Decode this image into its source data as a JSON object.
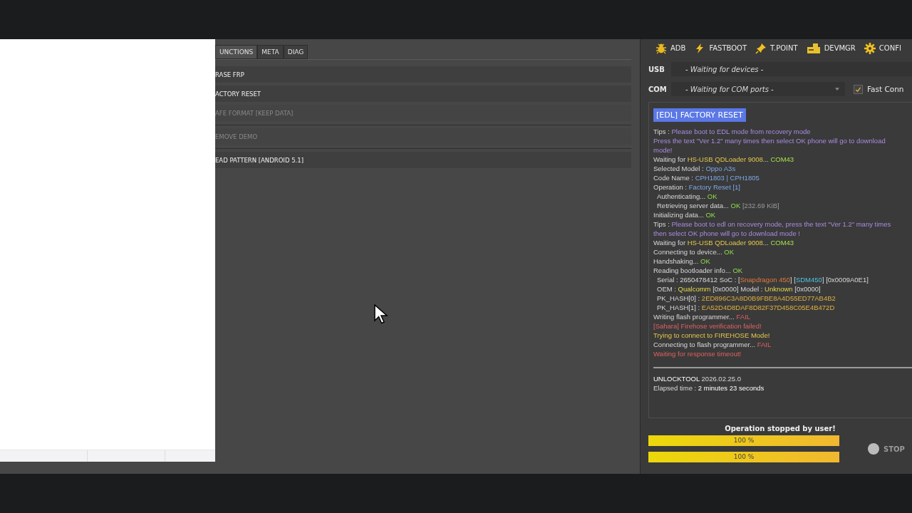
{
  "tabs": [
    {
      "label": "UNCTIONS",
      "selected": true
    },
    {
      "label": "META",
      "selected": false
    },
    {
      "label": "DIAG",
      "selected": false
    }
  ],
  "functions": [
    {
      "label": "RASE FRP",
      "disabled": false
    },
    {
      "label": "ACTORY RESET",
      "disabled": false
    },
    {
      "label": "AFE FORMAT [KEEP DATA]",
      "disabled": true
    },
    {
      "label": "EMOVE DEMO",
      "disabled": true
    },
    {
      "label": "EAD PATTERN [ANDROID 5.1]",
      "disabled": false
    }
  ],
  "toolbar": [
    {
      "label": "ADB",
      "kind": "bug"
    },
    {
      "label": "FASTBOOT",
      "kind": "bolt"
    },
    {
      "label": "T.POINT",
      "kind": "pin"
    },
    {
      "label": "DEVMGR",
      "kind": "device"
    },
    {
      "label": "CONFI",
      "kind": "gear"
    }
  ],
  "usb": {
    "label": "USB",
    "value": "- Waiting for devices -"
  },
  "com": {
    "label": "COM",
    "value": "- Waiting for COM ports -"
  },
  "fast_connect": {
    "label": "Fast Conn",
    "checked": true
  },
  "log_title": "[EDL] FACTORY RESET",
  "log": [
    {
      "indent": false,
      "parts": [
        {
          "text": "Tips : ",
          "kind": "plain"
        },
        {
          "text": "Please boot to EDL mode from recovery mode",
          "kind": "tip"
        }
      ]
    },
    {
      "indent": false,
      "parts": [
        {
          "text": "Press the text \"Ver 1.2\" many times then select OK phone will go to download mode!",
          "kind": "tip"
        }
      ]
    },
    {
      "indent": false,
      "parts": [
        {
          "text": "Waiting for ",
          "kind": "plain"
        },
        {
          "text": "HS-USB QDLoader 9008",
          "kind": "device"
        },
        {
          "text": "... ",
          "kind": "plain"
        },
        {
          "text": "COM43",
          "kind": "port"
        }
      ]
    },
    {
      "indent": false,
      "parts": [
        {
          "text": "Selected Model : ",
          "kind": "plain"
        },
        {
          "text": "Oppo A3s",
          "kind": "value"
        }
      ]
    },
    {
      "indent": false,
      "parts": [
        {
          "text": "Code Name : ",
          "kind": "plain"
        },
        {
          "text": "CPH1803 | CPH1805",
          "kind": "value"
        }
      ]
    },
    {
      "indent": false,
      "parts": [
        {
          "text": "Operation : ",
          "kind": "plain"
        },
        {
          "text": "Factory Reset [1]",
          "kind": "value"
        }
      ]
    },
    {
      "indent": true,
      "parts": [
        {
          "text": "Authenticating... ",
          "kind": "plain"
        },
        {
          "text": "OK",
          "kind": "ok"
        }
      ]
    },
    {
      "indent": true,
      "parts": [
        {
          "text": "Retrieving server data... ",
          "kind": "plain"
        },
        {
          "text": "OK ",
          "kind": "ok"
        },
        {
          "text": "[232.69 KiB]",
          "kind": "muted"
        }
      ]
    },
    {
      "indent": false,
      "parts": [
        {
          "text": "Initializing data... ",
          "kind": "plain"
        },
        {
          "text": "OK",
          "kind": "ok"
        }
      ]
    },
    {
      "indent": false,
      "parts": [
        {
          "text": "Tips : ",
          "kind": "plain"
        },
        {
          "text": "Please boot to edl on recovery mode, press the text \"Ver 1.2\" many times then select OK phone will go to download mode !",
          "kind": "tip"
        }
      ]
    },
    {
      "indent": false,
      "parts": [
        {
          "text": "Waiting for ",
          "kind": "plain"
        },
        {
          "text": "HS-USB QDLoader 9008",
          "kind": "device"
        },
        {
          "text": "... ",
          "kind": "plain"
        },
        {
          "text": "COM43",
          "kind": "port"
        }
      ]
    },
    {
      "indent": false,
      "parts": [
        {
          "text": "Connecting to device... ",
          "kind": "plain"
        },
        {
          "text": "OK",
          "kind": "ok"
        }
      ]
    },
    {
      "indent": false,
      "parts": [
        {
          "text": "Handshaking... ",
          "kind": "plain"
        },
        {
          "text": "OK",
          "kind": "ok"
        }
      ]
    },
    {
      "indent": false,
      "parts": [
        {
          "text": "Reading bootloader info... ",
          "kind": "plain"
        },
        {
          "text": "OK",
          "kind": "ok"
        }
      ]
    },
    {
      "indent": true,
      "parts": [
        {
          "text": "Serial : 2650478412 SoC : [",
          "kind": "plain"
        },
        {
          "text": "Snapdragon 450",
          "kind": "chip"
        },
        {
          "text": "] [",
          "kind": "plain"
        },
        {
          "text": "SDM450",
          "kind": "soc"
        },
        {
          "text": "] [0x0009A0E1]",
          "kind": "plain"
        }
      ]
    },
    {
      "indent": true,
      "parts": [
        {
          "text": "OEM : ",
          "kind": "plain"
        },
        {
          "text": "Qualcomm",
          "kind": "vendor"
        },
        {
          "text": " [0x0000] Model : ",
          "kind": "plain"
        },
        {
          "text": "Unknown",
          "kind": "vendor"
        },
        {
          "text": " [0x0000]",
          "kind": "plain"
        }
      ]
    },
    {
      "indent": true,
      "parts": [
        {
          "text": "PK_HASH[0] : ",
          "kind": "plain"
        },
        {
          "text": "2ED896C3A8D0B9FBE8A4D55ED77AB4B2",
          "kind": "hash"
        }
      ]
    },
    {
      "indent": true,
      "parts": [
        {
          "text": "PK_HASH[1] : ",
          "kind": "plain"
        },
        {
          "text": "EA52D4D8DAF8D82F37D458C05E4B472D",
          "kind": "hash"
        }
      ]
    },
    {
      "indent": false,
      "parts": [
        {
          "text": "Writing flash programmer... ",
          "kind": "plain"
        },
        {
          "text": "FAIL",
          "kind": "fail"
        }
      ]
    },
    {
      "indent": false,
      "parts": [
        {
          "text": "[Sahara] Firehose verification failed!",
          "kind": "fail"
        }
      ]
    },
    {
      "indent": false,
      "parts": [
        {
          "text": "Trying to connect to FIREHOSE Mode!",
          "kind": "device"
        }
      ]
    },
    {
      "indent": false,
      "parts": [
        {
          "text": "Connecting to flash programmer... ",
          "kind": "plain"
        },
        {
          "text": "FAIL",
          "kind": "fail"
        }
      ]
    },
    {
      "indent": false,
      "parts": [
        {
          "text": "Waiting for response timeout!",
          "kind": "fail"
        }
      ]
    }
  ],
  "footer": [
    {
      "parts": [
        {
          "text": "UNLOCKTOOL ",
          "kind": "strong"
        },
        {
          "text": "2026.02.25.0",
          "kind": "plain"
        }
      ]
    },
    {
      "parts": [
        {
          "text": "Elapsed time : ",
          "kind": "plain"
        },
        {
          "text": "2 minutes 23 seconds",
          "kind": "strong"
        }
      ]
    }
  ],
  "status": "Operation stopped by user!",
  "progress": [
    {
      "level": 1,
      "reading": "100 %"
    },
    {
      "level": 1,
      "reading": "100 %"
    }
  ],
  "stop": {
    "label": "STOP",
    "disabled": true
  }
}
